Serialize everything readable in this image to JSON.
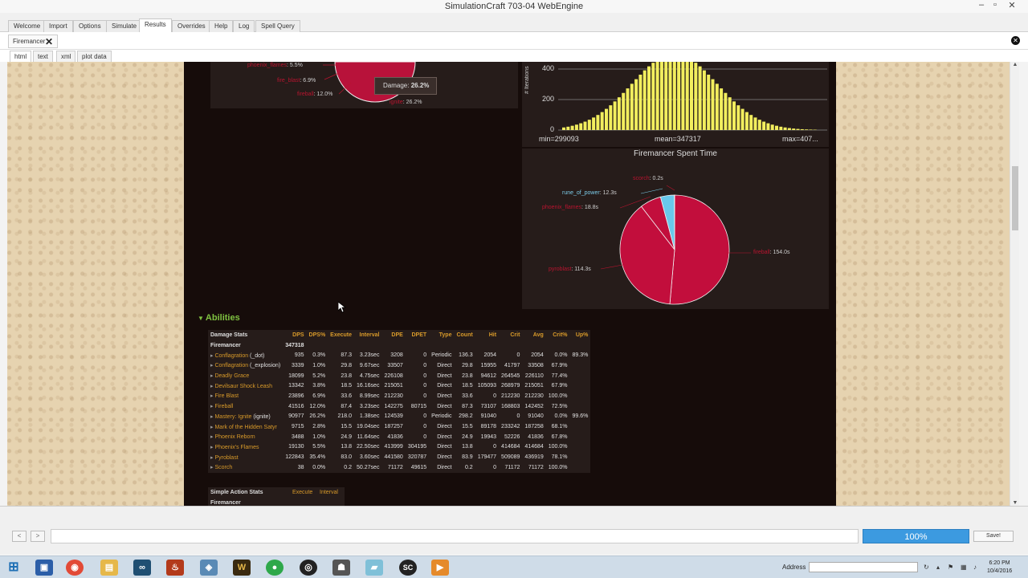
{
  "window": {
    "title": "SimulationCraft 703-04 WebEngine"
  },
  "main_tabs": [
    "Welcome",
    "Import",
    "Options",
    "Simulate",
    "Results",
    "Overrides",
    "Help",
    "Log",
    "Spell Query"
  ],
  "result_tab": "Firemancer",
  "format_tabs": [
    "html",
    "text",
    "xml",
    "plot data"
  ],
  "damage_pie_labels": {
    "phoenix_flames": "phoenix_flames",
    "phoenix_flames_pct": ": 5.5%",
    "fire_blast": "fire_blast",
    "fire_blast_pct": ": 6.9%",
    "fireball": "fireball",
    "fireball_pct": ": 12.0%",
    "ignite": "ignite",
    "ignite_pct": ": 26.2%",
    "tooltip_label": "Damage:",
    "tooltip_value": "26.2%"
  },
  "histogram": {
    "y_label": "# Iterations",
    "ticks": [
      "400",
      "200",
      "0"
    ],
    "min": "min=299093",
    "mean": "mean=347317",
    "max": "max=407..."
  },
  "spent_time": {
    "title": "Firemancer Spent Time",
    "scorch": "scorch",
    "scorch_val": ": 0.2s",
    "rune": "rune_of_power",
    "rune_val": ": 12.3s",
    "phoenix": "phoenix_flames",
    "phoenix_val": ": 18.8s",
    "fireball": "fireball",
    "fireball_val": ": 154.0s",
    "pyroblast": "pyroblast",
    "pyroblast_val": ": 114.3s"
  },
  "chart_data": {
    "type": "pie",
    "title": "Firemancer Spent Time",
    "slices": [
      {
        "name": "fireball",
        "value": 154.0
      },
      {
        "name": "pyroblast",
        "value": 114.3
      },
      {
        "name": "phoenix_flames",
        "value": 18.8
      },
      {
        "name": "rune_of_power",
        "value": 12.3
      },
      {
        "name": "scorch",
        "value": 0.2
      }
    ]
  },
  "abilities": {
    "heading": "Abilities",
    "headers": [
      "Damage Stats",
      "DPS",
      "DPS%",
      "Execute",
      "Interval",
      "DPE",
      "DPET",
      "Type",
      "Count",
      "Hit",
      "Crit",
      "Avg",
      "Crit%",
      "Up%"
    ],
    "player": {
      "name": "Firemancer",
      "dps": "347318"
    },
    "rows": [
      {
        "name": "Conflagration",
        "suffix": " (_dot)",
        "dps": "935",
        "pct": "0.3%",
        "exec": "87.3",
        "interval": "3.23sec",
        "dpe": "3208",
        "dpet": "0",
        "type": "Periodic",
        "count": "136.3",
        "hit": "2054",
        "crit": "0",
        "avg": "2054",
        "critp": "0.0%",
        "up": "89.3%"
      },
      {
        "name": "Conflagration",
        "suffix": " (_explosion)",
        "dps": "3339",
        "pct": "1.0%",
        "exec": "29.8",
        "interval": "9.67sec",
        "dpe": "33507",
        "dpet": "0",
        "type": "Direct",
        "count": "29.8",
        "hit": "15955",
        "crit": "41797",
        "avg": "33508",
        "critp": "67.9%",
        "up": ""
      },
      {
        "name": "Deadly Grace",
        "suffix": "",
        "dps": "18099",
        "pct": "5.2%",
        "exec": "23.8",
        "interval": "4.75sec",
        "dpe": "226108",
        "dpet": "0",
        "type": "Direct",
        "count": "23.8",
        "hit": "94612",
        "crit": "264545",
        "avg": "226110",
        "critp": "77.4%",
        "up": ""
      },
      {
        "name": "Devilsaur Shock Leash",
        "suffix": "",
        "dps": "13342",
        "pct": "3.8%",
        "exec": "18.5",
        "interval": "16.16sec",
        "dpe": "215051",
        "dpet": "0",
        "type": "Direct",
        "count": "18.5",
        "hit": "105093",
        "crit": "268979",
        "avg": "215051",
        "critp": "67.9%",
        "up": ""
      },
      {
        "name": "Fire Blast",
        "suffix": "",
        "dps": "23896",
        "pct": "6.9%",
        "exec": "33.6",
        "interval": "8.99sec",
        "dpe": "212230",
        "dpet": "0",
        "type": "Direct",
        "count": "33.6",
        "hit": "0",
        "crit": "212230",
        "avg": "212230",
        "critp": "100.0%",
        "up": ""
      },
      {
        "name": "Fireball",
        "suffix": "",
        "dps": "41516",
        "pct": "12.0%",
        "exec": "87.4",
        "interval": "3.23sec",
        "dpe": "142275",
        "dpet": "80715",
        "type": "Direct",
        "count": "87.3",
        "hit": "73107",
        "crit": "168803",
        "avg": "142452",
        "critp": "72.5%",
        "up": ""
      },
      {
        "name": "Mastery: Ignite",
        "suffix": " (ignite)",
        "dps": "90977",
        "pct": "26.2%",
        "exec": "218.0",
        "interval": "1.38sec",
        "dpe": "124539",
        "dpet": "0",
        "type": "Periodic",
        "count": "298.2",
        "hit": "91040",
        "crit": "0",
        "avg": "91040",
        "critp": "0.0%",
        "up": "99.6%"
      },
      {
        "name": "Mark of the Hidden Satyr",
        "suffix": "",
        "dps": "9715",
        "pct": "2.8%",
        "exec": "15.5",
        "interval": "19.04sec",
        "dpe": "187257",
        "dpet": "0",
        "type": "Direct",
        "count": "15.5",
        "hit": "89178",
        "crit": "233242",
        "avg": "187258",
        "critp": "68.1%",
        "up": ""
      },
      {
        "name": "Phoenix Reborn",
        "suffix": "",
        "dps": "3488",
        "pct": "1.0%",
        "exec": "24.9",
        "interval": "11.64sec",
        "dpe": "41836",
        "dpet": "0",
        "type": "Direct",
        "count": "24.9",
        "hit": "19943",
        "crit": "52226",
        "avg": "41836",
        "critp": "67.8%",
        "up": ""
      },
      {
        "name": "Phoenix's Flames",
        "suffix": "",
        "dps": "19130",
        "pct": "5.5%",
        "exec": "13.8",
        "interval": "22.50sec",
        "dpe": "413999",
        "dpet": "304195",
        "type": "Direct",
        "count": "13.8",
        "hit": "0",
        "crit": "414684",
        "avg": "414684",
        "critp": "100.0%",
        "up": ""
      },
      {
        "name": "Pyroblast",
        "suffix": "",
        "dps": "122843",
        "pct": "35.4%",
        "exec": "83.0",
        "interval": "3.60sec",
        "dpe": "441580",
        "dpet": "320787",
        "type": "Direct",
        "count": "83.9",
        "hit": "179477",
        "crit": "509089",
        "avg": "436919",
        "critp": "78.1%",
        "up": ""
      },
      {
        "name": "Scorch",
        "suffix": "",
        "dps": "38",
        "pct": "0.0%",
        "exec": "0.2",
        "interval": "50.27sec",
        "dpe": "71172",
        "dpet": "49615",
        "type": "Direct",
        "count": "0.2",
        "hit": "0",
        "crit": "71172",
        "avg": "71172",
        "critp": "100.0%",
        "up": ""
      }
    ]
  },
  "simple_action": {
    "title": "Simple Action Stats",
    "execute": "Execute",
    "interval": "Interval",
    "player": "Firemancer"
  },
  "bottom": {
    "back": "<",
    "forward": ">",
    "progress": "100%",
    "save": "Save!"
  },
  "taskbar": {
    "address_label": "Address",
    "time": "6:20 PM",
    "date": "10/4/2016"
  }
}
